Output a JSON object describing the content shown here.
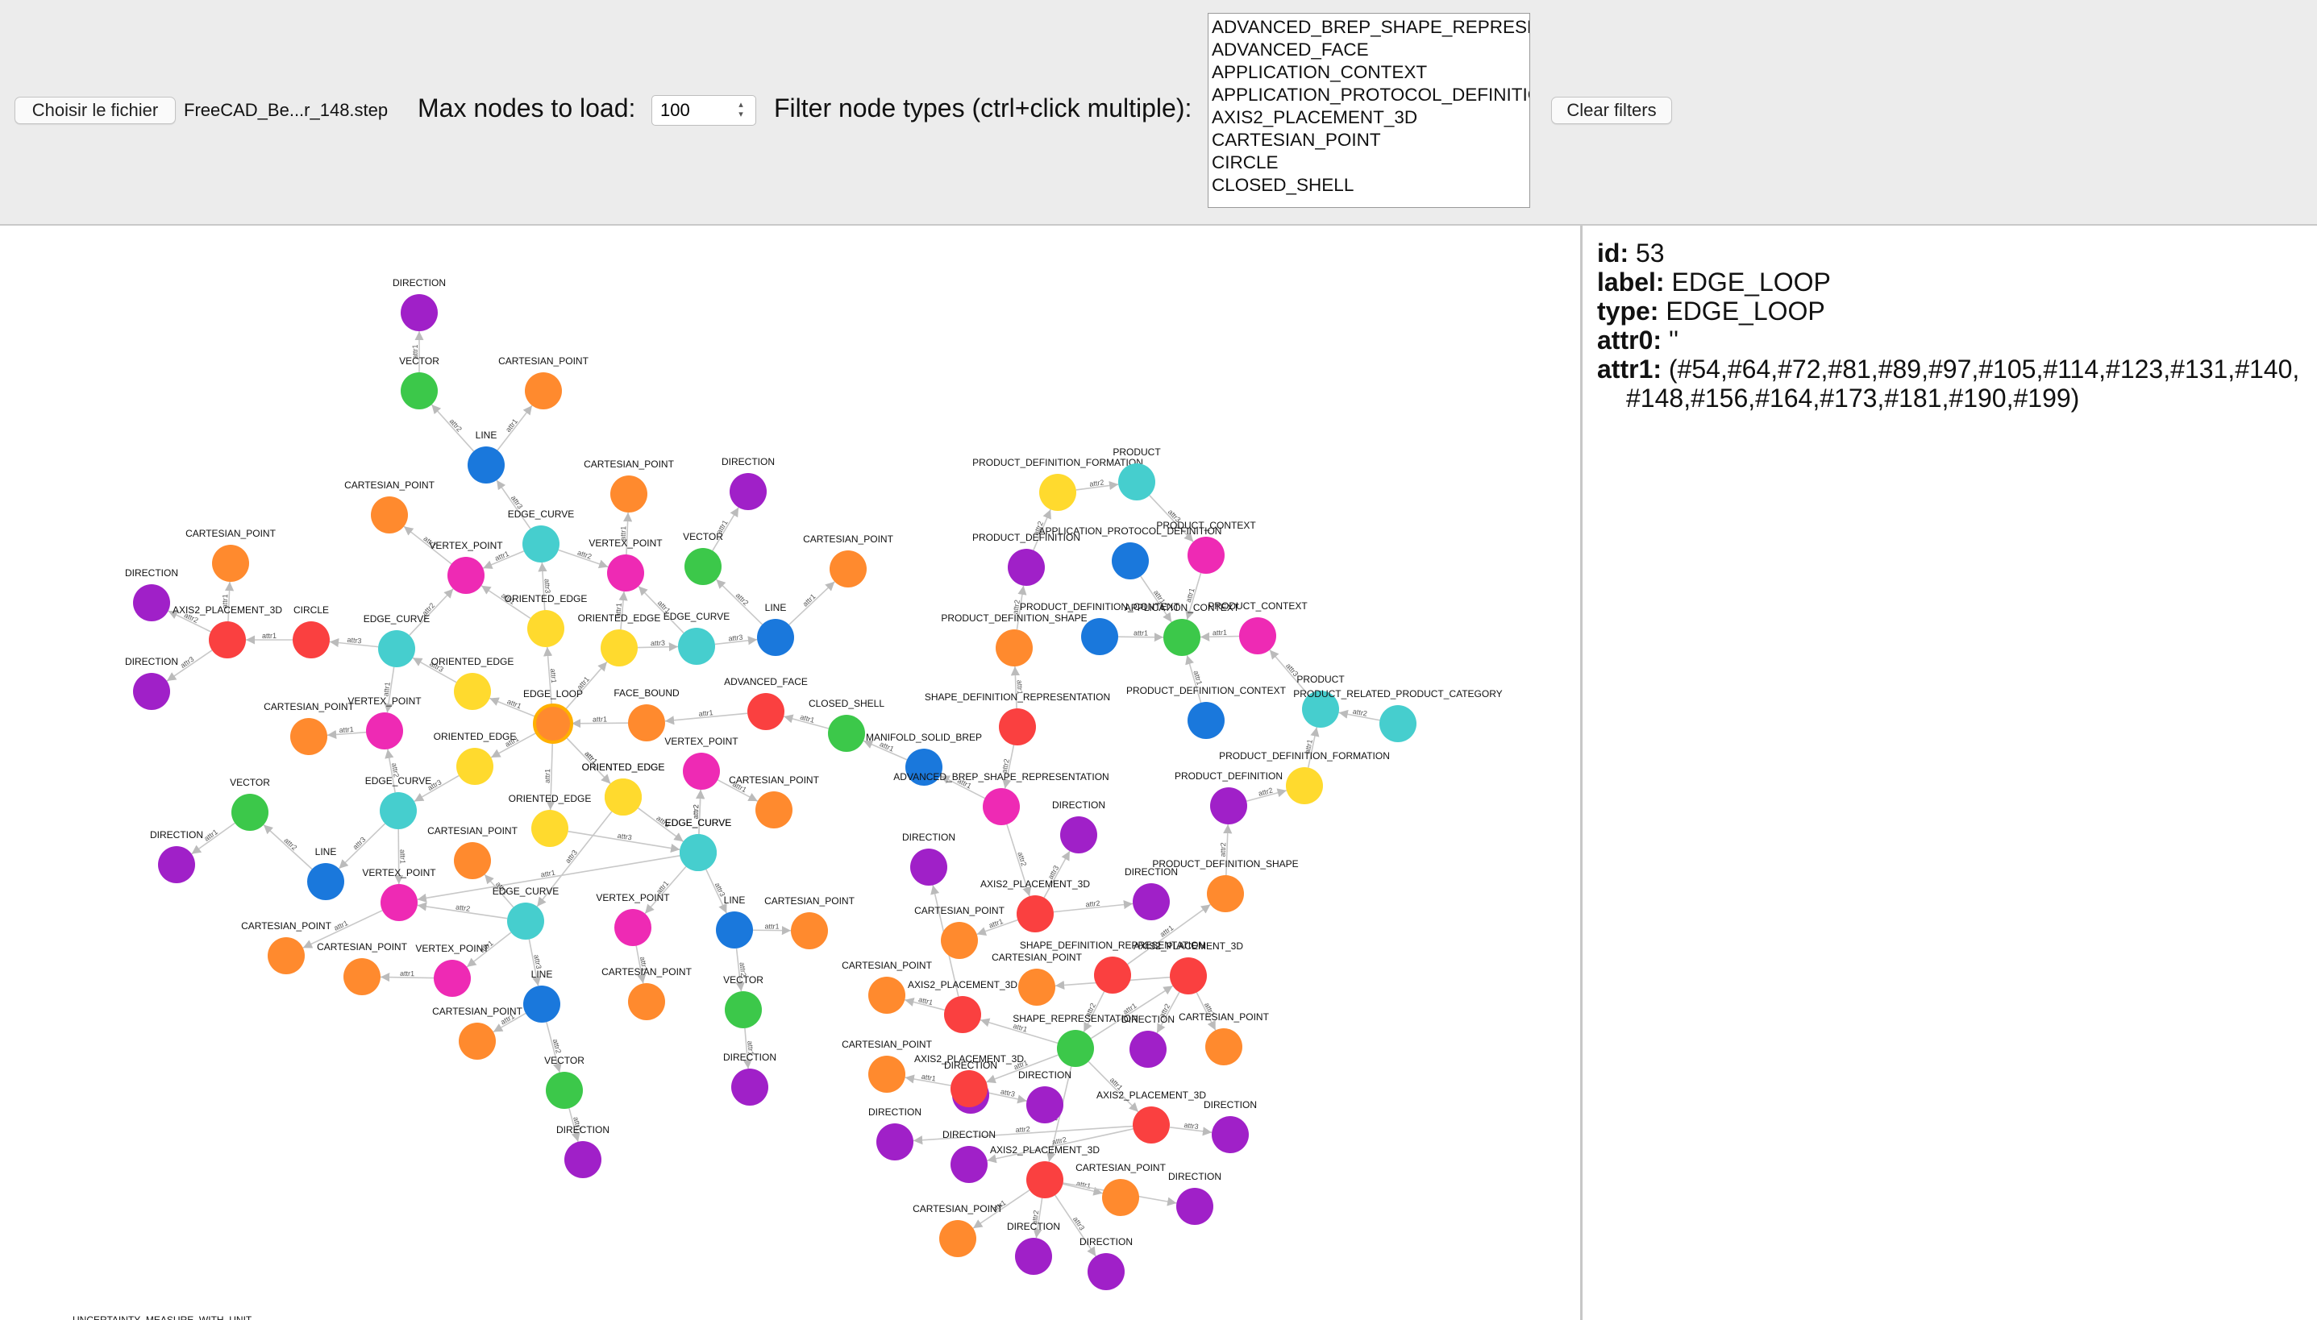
{
  "toolbar": {
    "file_button": "Choisir le fichier",
    "file_name": "FreeCAD_Be...r_148.step",
    "max_nodes_label": "Max nodes to load:",
    "max_nodes_value": "100",
    "filter_label": "Filter node types (ctrl+click multiple):",
    "filter_options": [
      "ADVANCED_BREP_SHAPE_REPRESENTATION",
      "ADVANCED_FACE",
      "APPLICATION_CONTEXT",
      "APPLICATION_PROTOCOL_DEFINITION",
      "AXIS2_PLACEMENT_3D",
      "CARTESIAN_POINT",
      "CIRCLE",
      "CLOSED_SHELL"
    ],
    "clear_button": "Clear filters"
  },
  "details": {
    "id_key": "id:",
    "id_value": "53",
    "label_key": "label:",
    "label_value": "EDGE_LOOP",
    "type_key": "type:",
    "type_value": "EDGE_LOOP",
    "attr0_key": "attr0:",
    "attr0_value": "''",
    "attr1_key": "attr1:",
    "attr1_value_line1": "(#54,#64,#72,#81,#89,#97,#105,#114,#123,#131,#140,",
    "attr1_value_line2": "#148,#156,#164,#173,#181,#190,#199)"
  },
  "colors": {
    "DIRECTION": "#a020c8",
    "VECTOR": "#3cc84a",
    "CARTESIAN_POINT": "#ff8a2e",
    "LINE": "#1a78dc",
    "EDGE_CURVE": "#46cece",
    "VERTEX_POINT": "#ee2ab4",
    "ORIENTED_EDGE": "#ffda2e",
    "AXIS2_PLACEMENT_3D": "#fa4040",
    "CIRCLE": "#fa4040",
    "EDGE_LOOP": "#ff8a2e",
    "FACE_BOUND": "#ff8a2e",
    "ADVANCED_FACE": "#fa4040",
    "CLOSED_SHELL": "#3cc84a",
    "MANIFOLD_SOLID_BREP": "#1a78dc",
    "ADVANCED_BREP_SHAPE_REPRESENTATION": "#ee2ab4",
    "PRODUCT_DEFINITION_FORMATION": "#ffda2e",
    "PRODUCT": "#46cece",
    "PRODUCT_DEFINITION": "#a020c8",
    "PRODUCT_CONTEXT": "#ee2ab4",
    "APPLICATION_PROTOCOL_DEFINITION": "#1a78dc",
    "PRODUCT_DEFINITION_SHAPE": "#ff8a2e",
    "PRODUCT_DEFINITION_CONTEXT": "#1a78dc",
    "APPLICATION_CONTEXT": "#3cc84a",
    "PRODUCT_RELATED_PRODUCT_CATEGORY": "#46cece",
    "SHAPE_DEFINITION_REPRESENTATION": "#fa4040",
    "SHAPE_REPRESENTATION": "#3cc84a"
  },
  "graph": {
    "selected_id": "loop",
    "nodes": [
      {
        "id": "d1",
        "label": "DIRECTION",
        "type": "DIRECTION"
      },
      {
        "id": "v1",
        "label": "VECTOR",
        "type": "VECTOR"
      },
      {
        "id": "cp1",
        "label": "CARTESIAN_POINT",
        "type": "CARTESIAN_POINT"
      },
      {
        "id": "ln1",
        "label": "LINE",
        "type": "LINE"
      },
      {
        "id": "cp2",
        "label": "CARTESIAN_POINT",
        "type": "CARTESIAN_POINT"
      },
      {
        "id": "cp3",
        "label": "CARTESIAN_POINT",
        "type": "CARTESIAN_POINT"
      },
      {
        "id": "ec1",
        "label": "EDGE_CURVE",
        "type": "EDGE_CURVE"
      },
      {
        "id": "vp1",
        "label": "VERTEX_POINT",
        "type": "VERTEX_POINT"
      },
      {
        "id": "vp2",
        "label": "VERTEX_POINT",
        "type": "VERTEX_POINT"
      },
      {
        "id": "d2",
        "label": "DIRECTION",
        "type": "DIRECTION"
      },
      {
        "id": "v2",
        "label": "VECTOR",
        "type": "VECTOR"
      },
      {
        "id": "cp4",
        "label": "CARTESIAN_POINT",
        "type": "CARTESIAN_POINT"
      },
      {
        "id": "ln2",
        "label": "LINE",
        "type": "LINE"
      },
      {
        "id": "ec2",
        "label": "EDGE_CURVE",
        "type": "EDGE_CURVE"
      },
      {
        "id": "oe1",
        "label": "ORIENTED_EDGE",
        "type": "ORIENTED_EDGE"
      },
      {
        "id": "oe2",
        "label": "ORIENTED_EDGE",
        "type": "ORIENTED_EDGE"
      },
      {
        "id": "cp5",
        "label": "CARTESIAN_POINT",
        "type": "CARTESIAN_POINT"
      },
      {
        "id": "d3",
        "label": "DIRECTION",
        "type": "DIRECTION"
      },
      {
        "id": "ax1",
        "label": "AXIS2_PLACEMENT_3D",
        "type": "AXIS2_PLACEMENT_3D"
      },
      {
        "id": "d4",
        "label": "DIRECTION",
        "type": "DIRECTION"
      },
      {
        "id": "ci1",
        "label": "CIRCLE",
        "type": "CIRCLE"
      },
      {
        "id": "ec3",
        "label": "EDGE_CURVE",
        "type": "EDGE_CURVE"
      },
      {
        "id": "oe3",
        "label": "ORIENTED_EDGE",
        "type": "ORIENTED_EDGE"
      },
      {
        "id": "loop",
        "label": "EDGE_LOOP",
        "type": "EDGE_LOOP"
      },
      {
        "id": "fb",
        "label": "FACE_BOUND",
        "type": "FACE_BOUND"
      },
      {
        "id": "af",
        "label": "ADVANCED_FACE",
        "type": "ADVANCED_FACE"
      },
      {
        "id": "cs",
        "label": "CLOSED_SHELL",
        "type": "CLOSED_SHELL"
      },
      {
        "id": "msb",
        "label": "MANIFOLD_SOLID_BREP",
        "type": "MANIFOLD_SOLID_BREP"
      },
      {
        "id": "vp3",
        "label": "VERTEX_POINT",
        "type": "VERTEX_POINT"
      },
      {
        "id": "cp6",
        "label": "CARTESIAN_POINT",
        "type": "CARTESIAN_POINT"
      },
      {
        "id": "oe4",
        "label": "ORIENTED_EDGE",
        "type": "ORIENTED_EDGE"
      },
      {
        "id": "oe5",
        "label": "ORIENTED_EDGE",
        "type": "ORIENTED_EDGE"
      },
      {
        "id": "oe6",
        "label": "ORIENTED_EDGE",
        "type": "ORIENTED_EDGE"
      },
      {
        "id": "vp4",
        "label": "VERTEX_POINT",
        "type": "VERTEX_POINT"
      },
      {
        "id": "cp7",
        "label": "CARTESIAN_POINT",
        "type": "CARTESIAN_POINT"
      },
      {
        "id": "ec4",
        "label": "EDGE_CURVE",
        "type": "EDGE_CURVE"
      },
      {
        "id": "ec5",
        "label": "EDGE_CURVE",
        "type": "EDGE_CURVE"
      },
      {
        "id": "v3",
        "label": "VECTOR",
        "type": "VECTOR"
      },
      {
        "id": "d5",
        "label": "DIRECTION",
        "type": "DIRECTION"
      },
      {
        "id": "ln3",
        "label": "LINE",
        "type": "LINE"
      },
      {
        "id": "vp5",
        "label": "VERTEX_POINT",
        "type": "VERTEX_POINT"
      },
      {
        "id": "cp8",
        "label": "CARTESIAN_POINT",
        "type": "CARTESIAN_POINT"
      },
      {
        "id": "ec6",
        "label": "EDGE_CURVE",
        "type": "EDGE_CURVE"
      },
      {
        "id": "cp9",
        "label": "CARTESIAN_POINT",
        "type": "CARTESIAN_POINT"
      },
      {
        "id": "cp10",
        "label": "CARTESIAN_POINT",
        "type": "CARTESIAN_POINT"
      },
      {
        "id": "vp6",
        "label": "VERTEX_POINT",
        "type": "VERTEX_POINT"
      },
      {
        "id": "ln4",
        "label": "LINE",
        "type": "LINE"
      },
      {
        "id": "cp11",
        "label": "CARTESIAN_POINT",
        "type": "CARTESIAN_POINT"
      },
      {
        "id": "v4",
        "label": "VECTOR",
        "type": "VECTOR"
      },
      {
        "id": "d6",
        "label": "DIRECTION",
        "type": "DIRECTION"
      },
      {
        "id": "oe7",
        "label": "ORIENTED_EDGE",
        "type": "ORIENTED_EDGE"
      },
      {
        "id": "ec7",
        "label": "EDGE_CURVE",
        "type": "EDGE_CURVE"
      },
      {
        "id": "vp7",
        "label": "VERTEX_POINT",
        "type": "VERTEX_POINT"
      },
      {
        "id": "cp12",
        "label": "CARTESIAN_POINT",
        "type": "CARTESIAN_POINT"
      },
      {
        "id": "ln5",
        "label": "LINE",
        "type": "LINE"
      },
      {
        "id": "cp13",
        "label": "CARTESIAN_POINT",
        "type": "CARTESIAN_POINT"
      },
      {
        "id": "v5",
        "label": "VECTOR",
        "type": "VECTOR"
      },
      {
        "id": "d7",
        "label": "DIRECTION",
        "type": "DIRECTION"
      },
      {
        "id": "pdf1",
        "label": "PRODUCT_DEFINITION_FORMATION",
        "type": "PRODUCT_DEFINITION_FORMATION"
      },
      {
        "id": "pr1",
        "label": "PRODUCT",
        "type": "PRODUCT"
      },
      {
        "id": "pd1",
        "label": "PRODUCT_DEFINITION",
        "type": "PRODUCT_DEFINITION"
      },
      {
        "id": "apd",
        "label": "APPLICATION_PROTOCOL_DEFINITION",
        "type": "APPLICATION_PROTOCOL_DEFINITION"
      },
      {
        "id": "pc1",
        "label": "PRODUCT_CONTEXT",
        "type": "PRODUCT_CONTEXT"
      },
      {
        "id": "pds1",
        "label": "PRODUCT_DEFINITION_SHAPE",
        "type": "PRODUCT_DEFINITION_SHAPE"
      },
      {
        "id": "pdc1",
        "label": "PRODUCT_DEFINITION_CONTEXT",
        "type": "PRODUCT_DEFINITION_CONTEXT"
      },
      {
        "id": "ac",
        "label": "APPLICATION_CONTEXT",
        "type": "APPLICATION_CONTEXT"
      },
      {
        "id": "pc2",
        "label": "PRODUCT_CONTEXT",
        "type": "PRODUCT_CONTEXT"
      },
      {
        "id": "pdc2",
        "label": "PRODUCT_DEFINITION_CONTEXT",
        "type": "PRODUCT_DEFINITION_CONTEXT"
      },
      {
        "id": "pr2",
        "label": "PRODUCT",
        "type": "PRODUCT"
      },
      {
        "id": "prpc",
        "label": "PRODUCT_RELATED_PRODUCT_CATEGORY",
        "type": "PRODUCT_RELATED_PRODUCT_CATEGORY"
      },
      {
        "id": "pdf2",
        "label": "PRODUCT_DEFINITION_FORMATION",
        "type": "PRODUCT_DEFINITION_FORMATION"
      },
      {
        "id": "pd2",
        "label": "PRODUCT_DEFINITION",
        "type": "PRODUCT_DEFINITION"
      },
      {
        "id": "pds2",
        "label": "PRODUCT_DEFINITION_SHAPE",
        "type": "PRODUCT_DEFINITION_SHAPE"
      },
      {
        "id": "sdr1",
        "label": "SHAPE_DEFINITION_REPRESENTATION",
        "type": "SHAPE_DEFINITION_REPRESENTATION"
      },
      {
        "id": "absr",
        "label": "ADVANCED_BREP_SHAPE_REPRESENTATION",
        "type": "ADVANCED_BREP_SHAPE_REPRESENTATION"
      },
      {
        "id": "d8",
        "label": "DIRECTION",
        "type": "DIRECTION"
      },
      {
        "id": "d9",
        "label": "DIRECTION",
        "type": "DIRECTION"
      },
      {
        "id": "ax2",
        "label": "AXIS2_PLACEMENT_3D",
        "type": "AXIS2_PLACEMENT_3D"
      },
      {
        "id": "cp14",
        "label": "CARTESIAN_POINT",
        "type": "CARTESIAN_POINT"
      },
      {
        "id": "d10",
        "label": "DIRECTION",
        "type": "DIRECTION"
      },
      {
        "id": "cp15",
        "label": "CARTESIAN_POINT",
        "type": "CARTESIAN_POINT"
      },
      {
        "id": "ax3",
        "label": "AXIS2_PLACEMENT_3D",
        "type": "AXIS2_PLACEMENT_3D"
      },
      {
        "id": "sdr2",
        "label": "SHAPE_DEFINITION_REPRESENTATION",
        "type": "SHAPE_DEFINITION_REPRESENTATION"
      },
      {
        "id": "cp16",
        "label": "CARTESIAN_POINT",
        "type": "CARTESIAN_POINT"
      },
      {
        "id": "ax4",
        "label": "AXIS2_PLACEMENT_3D",
        "type": "AXIS2_PLACEMENT_3D"
      },
      {
        "id": "cp17",
        "label": "CARTESIAN_POINT",
        "type": "CARTESIAN_POINT"
      },
      {
        "id": "sr",
        "label": "SHAPE_REPRESENTATION",
        "type": "SHAPE_REPRESENTATION"
      },
      {
        "id": "d11",
        "label": "DIRECTION",
        "type": "DIRECTION"
      },
      {
        "id": "cp18",
        "label": "CARTESIAN_POINT",
        "type": "CARTESIAN_POINT"
      },
      {
        "id": "d12",
        "label": "DIRECTION",
        "type": "DIRECTION"
      },
      {
        "id": "ax5",
        "label": "AXIS2_PLACEMENT_3D",
        "type": "AXIS2_PLACEMENT_3D"
      },
      {
        "id": "d13",
        "label": "DIRECTION",
        "type": "DIRECTION"
      },
      {
        "id": "d14",
        "label": "DIRECTION",
        "type": "DIRECTION"
      },
      {
        "id": "ax6",
        "label": "AXIS2_PLACEMENT_3D",
        "type": "AXIS2_PLACEMENT_3D"
      },
      {
        "id": "d15",
        "label": "DIRECTION",
        "type": "DIRECTION"
      },
      {
        "id": "d16",
        "label": "DIRECTION",
        "type": "DIRECTION"
      },
      {
        "id": "ax7",
        "label": "AXIS2_PLACEMENT_3D",
        "type": "AXIS2_PLACEMENT_3D"
      },
      {
        "id": "cp19",
        "label": "CARTESIAN_POINT",
        "type": "CARTESIAN_POINT"
      },
      {
        "id": "d17",
        "label": "DIRECTION",
        "type": "DIRECTION"
      },
      {
        "id": "cp20",
        "label": "CARTESIAN_POINT",
        "type": "CARTESIAN_POINT"
      },
      {
        "id": "d18",
        "label": "DIRECTION",
        "type": "DIRECTION"
      },
      {
        "id": "d19",
        "label": "DIRECTION",
        "type": "DIRECTION"
      },
      {
        "id": "umwu",
        "label": "UNCERTAINTY_MEASURE_WITH_UNIT",
        "type": "UNCERTAINTY_MEASURE_WITH_UNIT"
      }
    ],
    "edges": [
      [
        "v1",
        "d1",
        "attr1"
      ],
      [
        "ln1",
        "v1",
        "attr2"
      ],
      [
        "ln1",
        "cp1",
        "attr1"
      ],
      [
        "ec1",
        "ln1",
        "attr3"
      ],
      [
        "ec1",
        "vp1",
        "attr1"
      ],
      [
        "ec1",
        "vp2",
        "attr2"
      ],
      [
        "vp1",
        "cp3",
        "attr1"
      ],
      [
        "vp2",
        "cp2",
        "attr1"
      ],
      [
        "oe1",
        "ec1",
        "attr3"
      ],
      [
        "oe1",
        "vp1",
        "attr1"
      ],
      [
        "v2",
        "d2",
        "attr1"
      ],
      [
        "ln2",
        "v2",
        "attr2"
      ],
      [
        "ln2",
        "cp4",
        "attr1"
      ],
      [
        "ec2",
        "ln2",
        "attr3"
      ],
      [
        "ec2",
        "vp2",
        "attr1"
      ],
      [
        "oe2",
        "ec2",
        "attr3"
      ],
      [
        "oe2",
        "vp2",
        "attr1"
      ],
      [
        "ax1",
        "cp5",
        "attr1"
      ],
      [
        "ax1",
        "d3",
        "attr2"
      ],
      [
        "ax1",
        "d4",
        "attr3"
      ],
      [
        "ci1",
        "ax1",
        "attr1"
      ],
      [
        "ec3",
        "ci1",
        "attr3"
      ],
      [
        "ec3",
        "vp1",
        "attr2"
      ],
      [
        "ec3",
        "vp3",
        "attr1"
      ],
      [
        "oe3",
        "ec3",
        "attr3"
      ],
      [
        "vp3",
        "cp6",
        "attr1"
      ],
      [
        "loop",
        "oe1",
        "attr1"
      ],
      [
        "loop",
        "oe2",
        "attr1"
      ],
      [
        "loop",
        "oe3",
        "attr1"
      ],
      [
        "loop",
        "oe4",
        "attr1"
      ],
      [
        "loop",
        "oe5",
        "attr1"
      ],
      [
        "loop",
        "oe6",
        "attr1"
      ],
      [
        "loop",
        "oe7",
        "attr1"
      ],
      [
        "fb",
        "loop",
        "attr1"
      ],
      [
        "af",
        "fb",
        "attr1"
      ],
      [
        "cs",
        "af",
        "attr1"
      ],
      [
        "msb",
        "cs",
        "attr1"
      ],
      [
        "oe4",
        "ec4",
        "attr3"
      ],
      [
        "ec4",
        "vp3",
        "attr2"
      ],
      [
        "ec4",
        "ln3",
        "attr3"
      ],
      [
        "ec4",
        "vp5",
        "attr1"
      ],
      [
        "ln3",
        "v3",
        "attr2"
      ],
      [
        "v3",
        "d5",
        "attr1"
      ],
      [
        "vp5",
        "cp9",
        "attr1"
      ],
      [
        "oe6",
        "ec5",
        "attr3"
      ],
      [
        "ec5",
        "vp5",
        "attr1"
      ],
      [
        "ec5",
        "vp4",
        "attr2"
      ],
      [
        "vp4",
        "cp7",
        "attr1"
      ],
      [
        "ec6",
        "cp8",
        "attr1"
      ],
      [
        "ec6",
        "vp5",
        "attr2"
      ],
      [
        "ec6",
        "vp6",
        "attr1"
      ],
      [
        "ec6",
        "ln4",
        "attr3"
      ],
      [
        "vp6",
        "cp10",
        "attr1"
      ],
      [
        "ln4",
        "cp11",
        "attr1"
      ],
      [
        "ln4",
        "v4",
        "attr2"
      ],
      [
        "v4",
        "d6",
        "attr1"
      ],
      [
        "oe5",
        "ec6",
        "attr3"
      ],
      [
        "oe7",
        "ec7",
        "attr3"
      ],
      [
        "ec7",
        "vp4",
        "attr2"
      ],
      [
        "ec7",
        "vp7",
        "attr1"
      ],
      [
        "ec7",
        "ln5",
        "attr3"
      ],
      [
        "vp7",
        "cp12",
        "attr1"
      ],
      [
        "ln5",
        "cp13",
        "attr1"
      ],
      [
        "ln5",
        "v5",
        "attr2"
      ],
      [
        "v5",
        "d7",
        "attr1"
      ],
      [
        "pdf1",
        "pr1",
        "attr2"
      ],
      [
        "pd1",
        "pdf1",
        "attr2"
      ],
      [
        "pds1",
        "pd1",
        "attr2"
      ],
      [
        "pr1",
        "pc1",
        "attr3"
      ],
      [
        "pc1",
        "ac",
        "attr1"
      ],
      [
        "apd",
        "ac",
        "attr1"
      ],
      [
        "pdc1",
        "ac",
        "attr1"
      ],
      [
        "pc2",
        "ac",
        "attr1"
      ],
      [
        "pdc2",
        "ac",
        "attr1"
      ],
      [
        "pr2",
        "pc2",
        "attr3"
      ],
      [
        "prpc",
        "pr2",
        "attr2"
      ],
      [
        "pdf2",
        "pr2",
        "attr1"
      ],
      [
        "pd2",
        "pdf2",
        "attr2"
      ],
      [
        "pds2",
        "pd2",
        "attr2"
      ],
      [
        "sdr1",
        "pds1",
        "attr1"
      ],
      [
        "sdr1",
        "absr",
        "attr2"
      ],
      [
        "absr",
        "msb",
        "attr1"
      ],
      [
        "absr",
        "ax2",
        "attr2"
      ],
      [
        "ax2",
        "d8",
        "attr3"
      ],
      [
        "ax2",
        "d9",
        "attr2"
      ],
      [
        "ax2",
        "cp14",
        "attr1"
      ],
      [
        "sdr2",
        "pds2",
        "attr1"
      ],
      [
        "sdr2",
        "sr",
        "attr2"
      ],
      [
        "sr",
        "ax3",
        "attr1"
      ],
      [
        "sr",
        "ax4",
        "attr1"
      ],
      [
        "sr",
        "ax5",
        "attr1"
      ],
      [
        "sr",
        "ax6",
        "attr1"
      ],
      [
        "sr",
        "ax7",
        "attr1"
      ],
      [
        "ax3",
        "cp15",
        "attr1"
      ],
      [
        "ax3",
        "d10",
        "attr2"
      ],
      [
        "ax4",
        "cp16",
        "attr1"
      ],
      [
        "ax4",
        "d11",
        "attr2"
      ],
      [
        "ax4",
        "cp17",
        "attr1"
      ],
      [
        "ax5",
        "cp18",
        "attr1"
      ],
      [
        "ax5",
        "d12",
        "attr2"
      ],
      [
        "ax5",
        "d13",
        "attr3"
      ],
      [
        "ax6",
        "d14",
        "attr2"
      ],
      [
        "ax6",
        "d15",
        "attr3"
      ],
      [
        "ax6",
        "d16",
        "attr2"
      ],
      [
        "ax7",
        "cp19",
        "attr1"
      ],
      [
        "ax7",
        "d17",
        "attr2"
      ],
      [
        "ax7",
        "cp20",
        "attr1"
      ],
      [
        "ax7",
        "d18",
        "attr2"
      ],
      [
        "ax7",
        "d19",
        "attr3"
      ]
    ]
  }
}
